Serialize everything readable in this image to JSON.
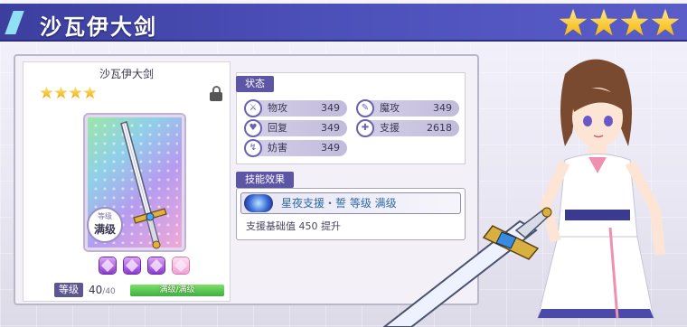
{
  "header": {
    "title": "沙瓦伊大剑",
    "stars": 4
  },
  "weapon": {
    "name": "沙瓦伊大剑",
    "stars": 4,
    "level_badge_small": "等级",
    "level_badge": "满级",
    "gems": [
      "purple",
      "purple",
      "purple",
      "pink"
    ],
    "level_label": "等级",
    "level_current": "40",
    "level_max": "/40",
    "level_bar_text": "满级/满级",
    "level_progress": 1.0
  },
  "stats": {
    "section_label": "状态",
    "items": [
      {
        "icon": "sword-icon",
        "label": "物攻",
        "value": "349"
      },
      {
        "icon": "wand-icon",
        "label": "魔攻",
        "value": "349"
      },
      {
        "icon": "heal-icon",
        "label": "回复",
        "value": "349"
      },
      {
        "icon": "support-icon",
        "label": "支援",
        "value": "2618"
      },
      {
        "icon": "debuff-icon",
        "label": "妨害",
        "value": "349"
      }
    ]
  },
  "skill": {
    "section_label": "技能效果",
    "title": "星夜支援・誓  等级 满级",
    "description": "支援基础值 450 提升"
  },
  "colors": {
    "banner": "#4b4fb8",
    "accent": "#5d55a6",
    "star": "#f5b400"
  }
}
